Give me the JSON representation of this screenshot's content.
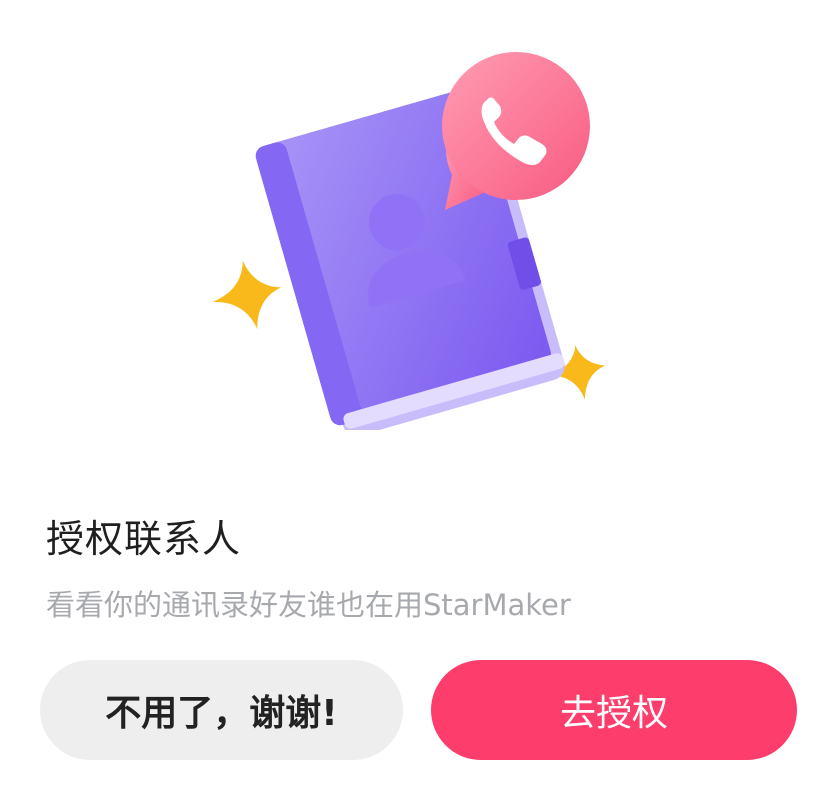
{
  "dialog": {
    "title": "授权联系人",
    "subtitle": "看看你的通讯录好友谁也在用StarMaker",
    "cancel_label": "不用了，谢谢!",
    "confirm_label": "去授权"
  },
  "icons": {
    "illustration": "contacts-book-icon",
    "phone_bubble": "phone-icon",
    "sparkles": "star-icon"
  },
  "colors": {
    "primary": "#fd3d6b",
    "book": "#8a6cf2",
    "bubble": "#fb6f8e",
    "sparkle": "#f9b91a",
    "cancel_bg": "#eeeeee",
    "subtitle": "#a7a9ae"
  }
}
